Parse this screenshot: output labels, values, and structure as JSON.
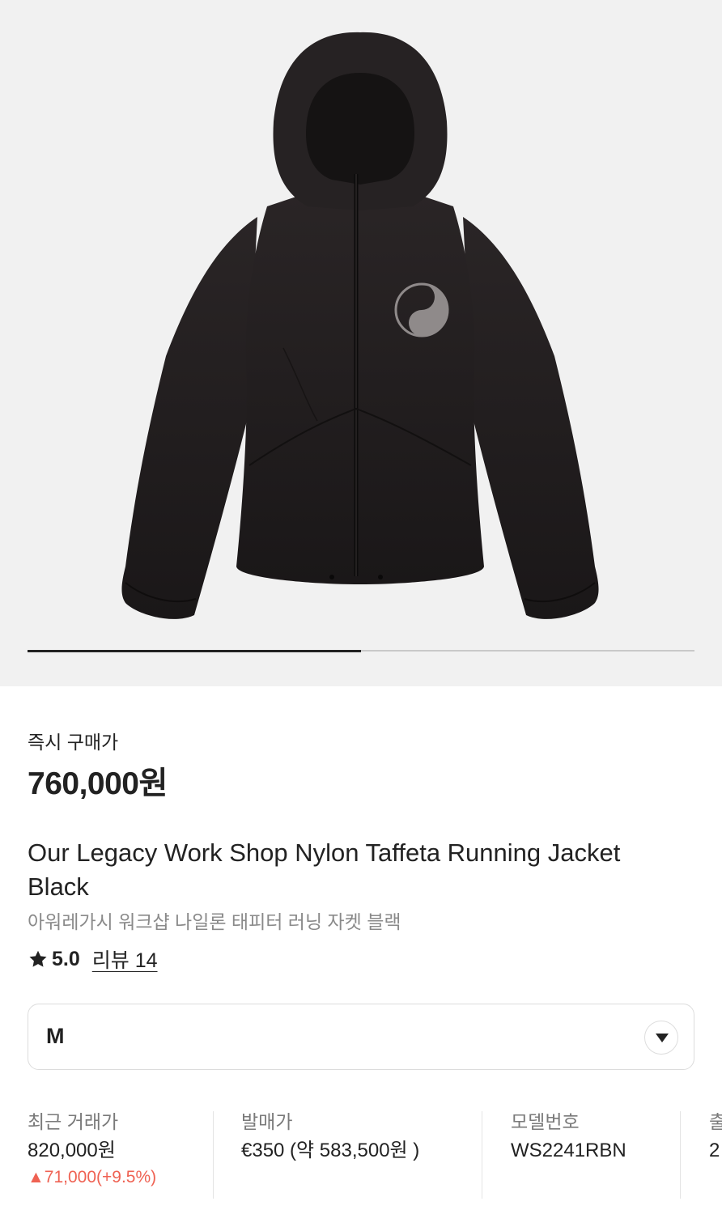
{
  "product": {
    "price_label": "즉시 구매가",
    "price": "760,000원",
    "name_en": "Our Legacy Work Shop Nylon Taffeta Running Jacket Black",
    "name_ko": "아워레가시 워크샵 나일론 태피터 러닝 자켓 블랙",
    "rating": "5.0",
    "review_link": "리뷰 14"
  },
  "gallery": {
    "progress": 0.5,
    "image_alt": "Black nylon hooded running jacket with circular logo"
  },
  "size_selector": {
    "selected": "M"
  },
  "info": [
    {
      "label": "최근 거래가",
      "value": "820,000원",
      "change": "▲71,000(+9.5%)"
    },
    {
      "label": "발매가",
      "value": "€350 (약 583,500원 )"
    },
    {
      "label": "모델번호",
      "value": "WS2241RBN"
    },
    {
      "label": "출",
      "value": "2"
    }
  ],
  "colors": {
    "accent_up": "#ef6253",
    "text": "#222222",
    "muted": "#8a8a8a",
    "hero_bg": "#f1f1f1"
  }
}
